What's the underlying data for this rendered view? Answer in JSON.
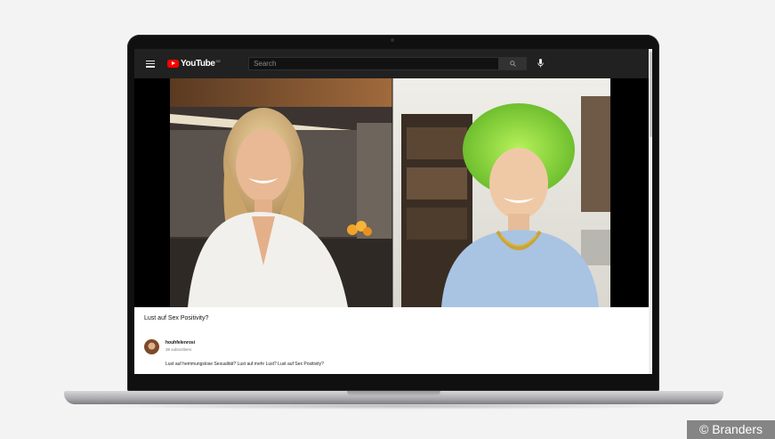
{
  "header": {
    "logo_text": "YouTube",
    "logo_superscript": "DE",
    "search_placeholder": "Search"
  },
  "video": {
    "title": "Lust auf Sex Positivity?"
  },
  "channel": {
    "name": "houhfelenrosi",
    "subscribers": "39 subscribers"
  },
  "description": "Lust auf hemmungslose Sexualität? Lust auf mehr Lust? Lust auf Sex Positivity?",
  "watermark": "© Branders",
  "colors": {
    "header_bg": "#212121",
    "brand_red": "#ff0000",
    "hair_green": "#9be04a"
  }
}
